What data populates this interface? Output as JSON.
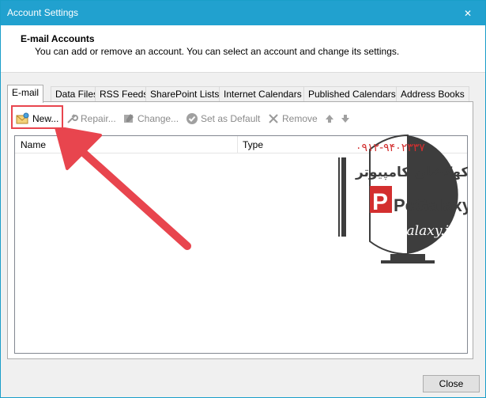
{
  "window": {
    "title": "Account Settings",
    "close_glyph": "✕"
  },
  "header": {
    "title": "E-mail Accounts",
    "subtitle": "You can add or remove an account. You can select an account and change its settings."
  },
  "tabs": [
    {
      "label": "E-mail",
      "active": true
    },
    {
      "label": "Data Files"
    },
    {
      "label": "RSS Feeds"
    },
    {
      "label": "SharePoint Lists"
    },
    {
      "label": "Internet Calendars"
    },
    {
      "label": "Published Calendars"
    },
    {
      "label": "Address Books"
    }
  ],
  "toolbar": {
    "new_label": "New...",
    "repair_label": "Repair...",
    "change_label": "Change...",
    "set_default_label": "Set as Default",
    "remove_label": "Remove"
  },
  "list": {
    "columns": [
      "Name",
      "Type"
    ]
  },
  "watermark": {
    "phone": "۰۹۱۲-۹۴۰۲۳۳۷",
    "persian_text": "کهکشان کامپیوتر",
    "brand": "PcGalaxy",
    "url": "PcGalaxy.ir"
  },
  "footer": {
    "close_label": "Close"
  },
  "colors": {
    "titlebar": "#21a1cf",
    "highlight": "#e8454e",
    "watermark_gray": "#3d3d3d",
    "watermark_red": "#d32f2f"
  }
}
